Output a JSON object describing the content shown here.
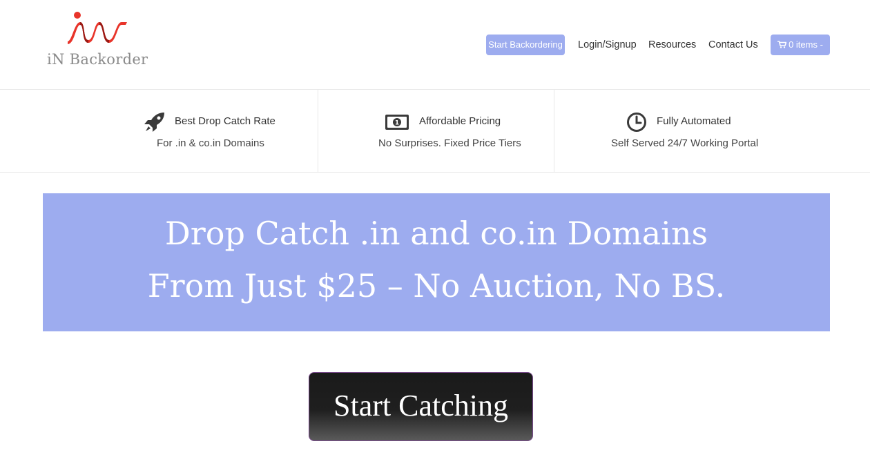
{
  "brand": {
    "name": "iN Backorder",
    "logo_colors": {
      "primary": "#e8342a",
      "secondary": "#b8201a"
    }
  },
  "nav": {
    "start_backordering": "Start Backordering",
    "login_signup": "Login/Signup",
    "resources": "Resources",
    "contact_us": "Contact Us",
    "cart_label": "0 items -",
    "cart_icon": "shopping-cart-icon"
  },
  "features": [
    {
      "icon": "rocket-icon",
      "title": "Best Drop Catch Rate",
      "subtitle": "For .in & co.in Domains"
    },
    {
      "icon": "money-icon",
      "title": "Affordable Pricing",
      "subtitle": "No Surprises. Fixed Price Tiers"
    },
    {
      "icon": "clock-icon",
      "title": "Fully Automated",
      "subtitle": "Self Served 24/7 Working Portal"
    }
  ],
  "banner": {
    "line1": "Drop Catch .in and co.in Domains",
    "line2": "From Just $25 – No Auction, No BS."
  },
  "cta": {
    "label": "Start Catching"
  },
  "colors": {
    "accent": "#9dacef",
    "cta_bg": "#1f1f1f",
    "cta_border": "#7b4b8f"
  }
}
